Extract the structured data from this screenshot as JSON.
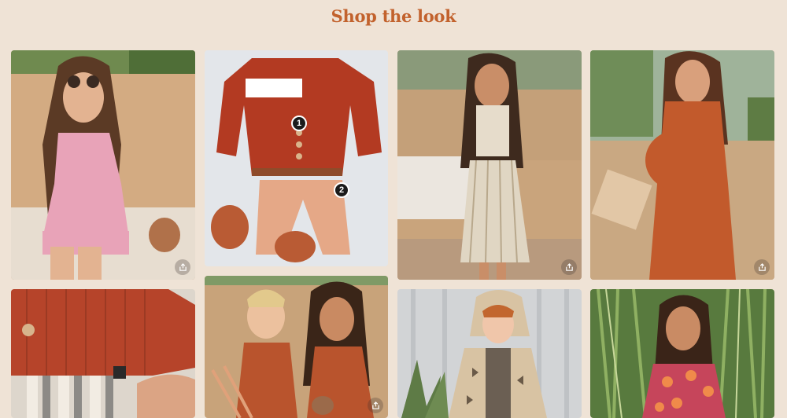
{
  "header": {
    "title": "Shop the look"
  },
  "tiles": [
    {
      "scene": "Girl in sunglasses and pink dress sitting on clay bench"
    },
    {
      "scene": "Rust knit cardigan, peach pants and leather booties flat lay",
      "hotspots": [
        "1",
        "2"
      ]
    },
    {
      "scene": "Girl in striped crop top and skirt standing by clay bench"
    },
    {
      "scene": "Pregnant woman in rust maxi dress in greenhouse"
    },
    {
      "scene": "Close-up of rust knit cardigan over striped pants"
    },
    {
      "scene": "Boy and girl in rust outfits sitting against clay wall"
    },
    {
      "scene": "Child in beige printed hooded jacket"
    },
    {
      "scene": "Girl in red floral dress among tall grass"
    }
  ],
  "colors": {
    "background": "#efe3d6",
    "title": "#c2622d"
  }
}
